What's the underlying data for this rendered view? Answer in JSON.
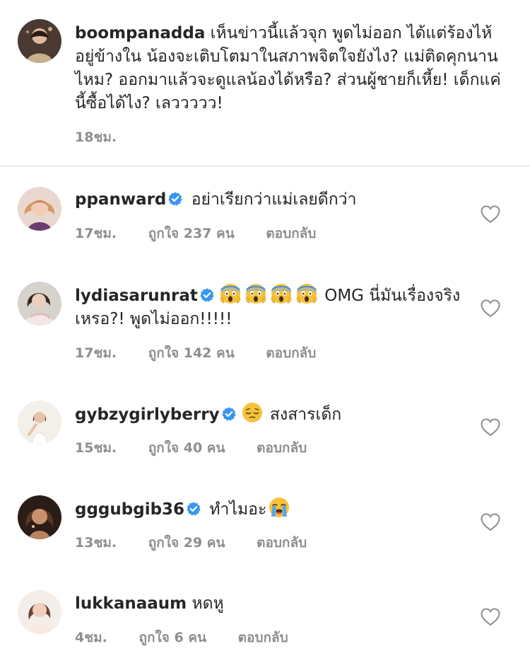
{
  "caption": {
    "username": "boompanadda",
    "text": "เห็นข่าวนี้แล้วจุก พูดไม่ออก ได้แต่ร้องไห้อยู่ข้างใน น้องจะเติบโตมาในสภาพจิตใจยังไง? แม่ติดคุกนานไหม? ออกมาแล้วจะดูแลน้องได้หรือ? ส่วนผู้ชายก็เหี้ย! เด็กแค่นี้ซื้อได้ไง? เลววววว!",
    "time": "18ชม."
  },
  "reply_label": "ตอบกลับ",
  "colors": {
    "verified": "#3897f0",
    "meta": "#8e8e8e",
    "divider": "#dbdbdb",
    "text": "#262626"
  },
  "icons": {
    "verified": "verified-badge-icon",
    "like": "heart-outline-icon",
    "emoji_scream": "face-screaming-in-fear-emoji",
    "emoji_pensive": "pensive-face-emoji",
    "emoji_crying": "loudly-crying-face-emoji"
  },
  "comments": [
    {
      "username": "ppanward",
      "verified": true,
      "text": "อย่าเรียกว่าแม่เลยดีกว่า",
      "time": "17ชม.",
      "likes": "ถูกใจ 237 คน"
    },
    {
      "username": "lydiasarunrat",
      "verified": true,
      "text_prefix_emojis": [
        "😱",
        "😱",
        "😱",
        "😱"
      ],
      "text": "OMG นี่มันเรื่องจริงเหรอ?! พูดไม่ออก!!!!!",
      "time": "17ชม.",
      "likes": "ถูกใจ 142 คน"
    },
    {
      "username": "gybzygirlyberry",
      "verified": true,
      "text_prefix_emojis": [
        "😔"
      ],
      "text": "สงสารเด็ก",
      "time": "15ชม.",
      "likes": "ถูกใจ 40 คน"
    },
    {
      "username": "gggubgib36",
      "verified": true,
      "text": "ทำไมอะ",
      "text_suffix_emojis": [
        "😭"
      ],
      "time": "13ชม.",
      "likes": "ถูกใจ 29 คน"
    },
    {
      "username": "lukkanaaum",
      "verified": false,
      "text": "หดหู",
      "time": "4ชม.",
      "likes": "ถูกใจ 6 คน"
    }
  ]
}
